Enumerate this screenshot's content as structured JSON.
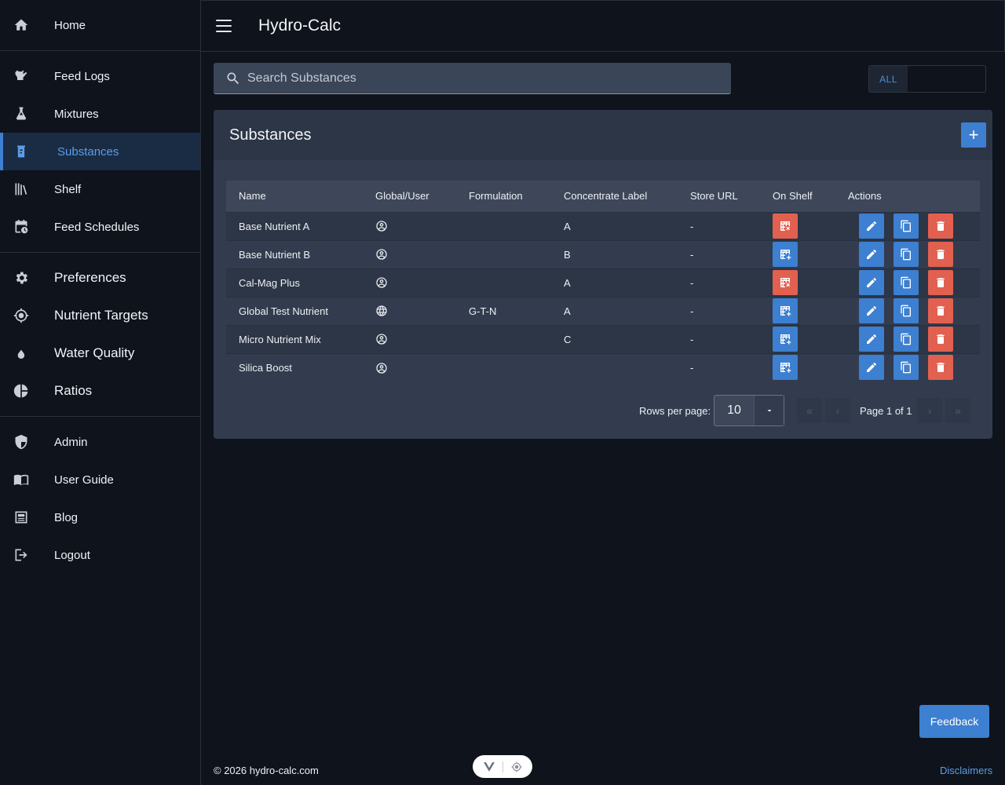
{
  "app": {
    "title": "Hydro-Calc"
  },
  "sidebar": {
    "groups": [
      [
        {
          "label": "Home",
          "icon": "home-icon"
        }
      ],
      [
        {
          "label": "Feed Logs",
          "icon": "watering-can-icon"
        },
        {
          "label": "Mixtures",
          "icon": "flask-icon"
        },
        {
          "label": "Substances",
          "icon": "bottle-icon",
          "active": true
        },
        {
          "label": "Shelf",
          "icon": "bookshelf-icon"
        },
        {
          "label": "Feed Schedules",
          "icon": "calendar-clock-icon"
        }
      ],
      [
        {
          "label": "Preferences",
          "icon": "gear-icon"
        },
        {
          "label": "Nutrient Targets",
          "icon": "crosshair-icon"
        },
        {
          "label": "Water Quality",
          "icon": "water-drop-icon"
        },
        {
          "label": "Ratios",
          "icon": "pie-chart-icon"
        }
      ],
      [
        {
          "label": "Admin",
          "icon": "shield-icon"
        },
        {
          "label": "User Guide",
          "icon": "book-icon"
        },
        {
          "label": "Blog",
          "icon": "newspaper-icon"
        },
        {
          "label": "Logout",
          "icon": "logout-icon"
        }
      ]
    ]
  },
  "search": {
    "placeholder": "Search Substances"
  },
  "filter": {
    "all_label": "ALL"
  },
  "card": {
    "title": "Substances",
    "add_label": "+"
  },
  "table": {
    "columns": [
      "Name",
      "Global/User",
      "Formulation",
      "Concentrate Label",
      "Store URL",
      "On Shelf",
      "Actions"
    ],
    "rows": [
      {
        "name": "Base Nutrient A",
        "scope": "user",
        "formulation": "",
        "concentrate_label": "A",
        "store_url": "-",
        "on_shelf": true
      },
      {
        "name": "Base Nutrient B",
        "scope": "user",
        "formulation": "",
        "concentrate_label": "B",
        "store_url": "-",
        "on_shelf": false
      },
      {
        "name": "Cal-Mag Plus",
        "scope": "user",
        "formulation": "",
        "concentrate_label": "A",
        "store_url": "-",
        "on_shelf": true
      },
      {
        "name": "Global Test Nutrient",
        "scope": "global",
        "formulation": "G-T-N",
        "concentrate_label": "A",
        "store_url": "-",
        "on_shelf": false
      },
      {
        "name": "Micro Nutrient Mix",
        "scope": "user",
        "formulation": "",
        "concentrate_label": "C",
        "store_url": "-",
        "on_shelf": false
      },
      {
        "name": "Silica Boost",
        "scope": "user",
        "formulation": "",
        "concentrate_label": "",
        "store_url": "-",
        "on_shelf": false
      }
    ]
  },
  "pagination": {
    "rows_per_page_label": "Rows per page:",
    "rows_per_page": "10",
    "page_label": "Page 1 of 1"
  },
  "footer": {
    "copyright": "© 2026 hydro-calc.com",
    "disclaimers": "Disclaimers",
    "feedback": "Feedback"
  },
  "colors": {
    "accent": "#3d7fd0",
    "danger": "#e2604f",
    "background": "#0f131b",
    "card": "#323c4e"
  }
}
